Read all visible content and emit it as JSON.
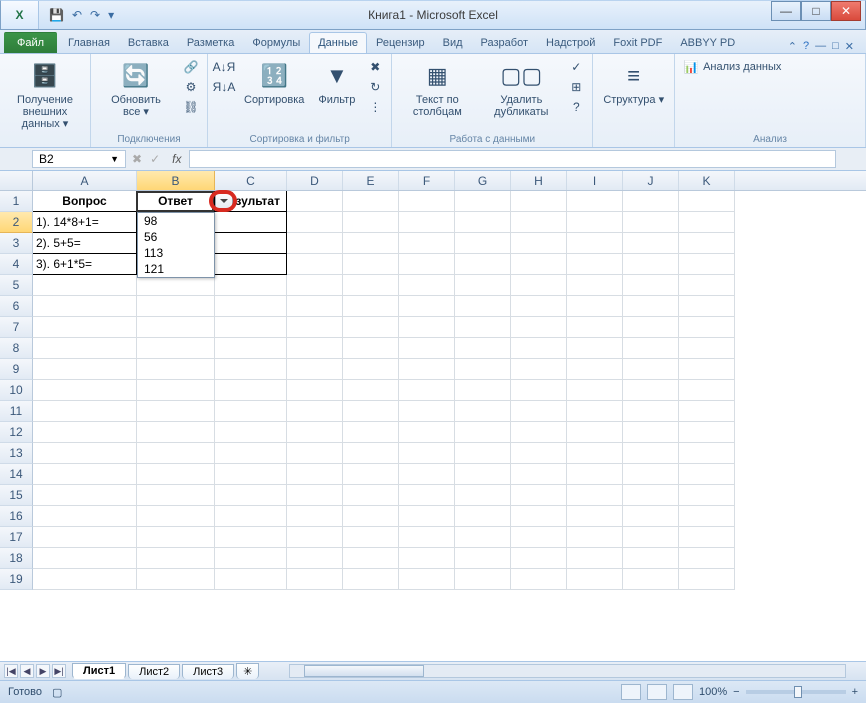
{
  "window": {
    "title": "Книга1 - Microsoft Excel",
    "logo": "X"
  },
  "qat": {
    "save": "💾",
    "undo": "↶",
    "redo": "↷",
    "more": "▾"
  },
  "tabs": {
    "file": "Файл",
    "items": [
      "Главная",
      "Вставка",
      "Разметка",
      "Формулы",
      "Данные",
      "Рецензир",
      "Вид",
      "Разработ",
      "Надстрой",
      "Foxit PDF",
      "ABBYY PD"
    ],
    "active_index": 4
  },
  "ribbon": {
    "g1": {
      "btn": "Получение внешних данных ▾",
      "label": ""
    },
    "g2": {
      "btn": "Обновить все ▾",
      "s1": "Подключения",
      "s2": "Свойства",
      "s3": "Изменить связи",
      "label": "Подключения"
    },
    "g3": {
      "sort_az": "А↓Я",
      "sort_za": "Я↓А",
      "sort": "Сортировка",
      "filter": "Фильтр",
      "clear": "Очистить",
      "reapply": "Применить повторно",
      "adv": "Дополнительно",
      "label": "Сортировка и фильтр"
    },
    "g4": {
      "ttc": "Текст по столбцам",
      "dup": "Удалить дубликаты",
      "val": "Проверка данных",
      "cons": "Консолидация",
      "what": "Анализ что-если",
      "label": "Работа с данными"
    },
    "g5": {
      "btn": "Структура ▾",
      "label": ""
    },
    "g6": {
      "btn": "Анализ данных",
      "label": "Анализ"
    }
  },
  "fbar": {
    "namebox": "B2",
    "fx": "fx",
    "formula": ""
  },
  "cols": [
    "A",
    "B",
    "C",
    "D",
    "E",
    "F",
    "G",
    "H",
    "I",
    "J",
    "K"
  ],
  "rows": [
    "1",
    "2",
    "3",
    "4",
    "5",
    "6",
    "7",
    "8",
    "9",
    "10",
    "11",
    "12",
    "13",
    "14",
    "15",
    "16",
    "17",
    "18",
    "19"
  ],
  "data": {
    "A1": "Вопрос",
    "B1": "Ответ",
    "C1": "Результат",
    "A2": "1). 14*8+1=",
    "A3": "2). 5+5=",
    "A4": "3). 6+1*5="
  },
  "dropdown": {
    "items": [
      "98",
      "56",
      "113",
      "121"
    ]
  },
  "sheets": {
    "active": "Лист1",
    "others": [
      "Лист2",
      "Лист3"
    ]
  },
  "status": {
    "ready": "Готово",
    "zoom": "100%",
    "minus": "−",
    "plus": "+"
  }
}
